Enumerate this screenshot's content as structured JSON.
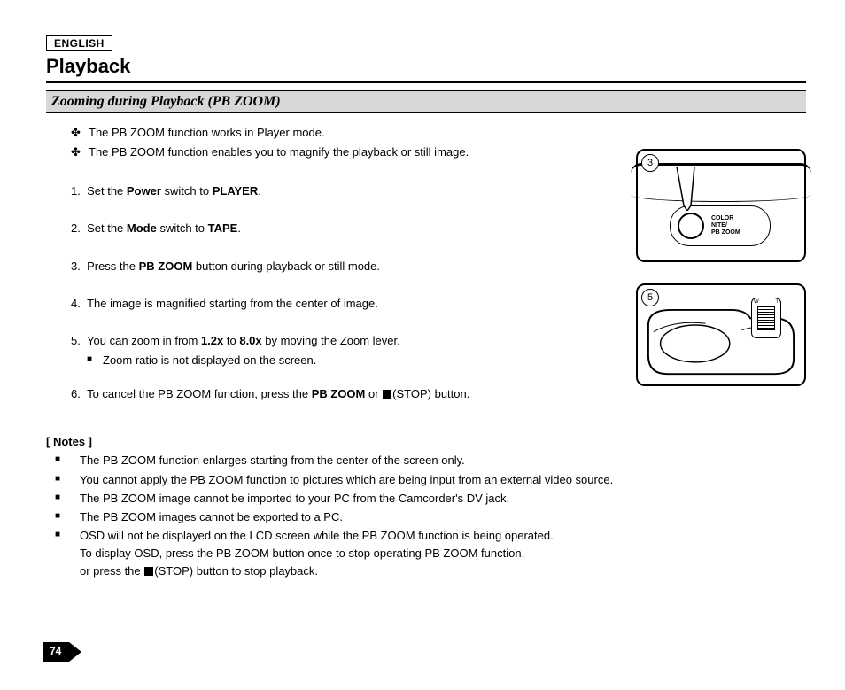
{
  "language": "ENGLISH",
  "title": "Playback",
  "section": "Zooming during Playback (PB ZOOM)",
  "intro": [
    "The PB ZOOM function works in Player mode.",
    "The PB ZOOM function enables you to magnify the playback or still image."
  ],
  "steps": {
    "s1_pre": "Set the ",
    "s1_b1": "Power",
    "s1_mid": " switch to ",
    "s1_b2": "PLAYER",
    "s1_post": ".",
    "s2_pre": "Set the ",
    "s2_b1": "Mode",
    "s2_mid": " switch to ",
    "s2_b2": "TAPE",
    "s2_post": ".",
    "s3_pre": "Press the ",
    "s3_b1": "PB ZOOM",
    "s3_post": " button during playback or still mode.",
    "s4": "The image is magnified starting from the center of image.",
    "s5_pre": "You can zoom in from ",
    "s5_b1": "1.2x",
    "s5_mid": " to ",
    "s5_b2": "8.0x",
    "s5_post": " by moving the Zoom lever.",
    "s5_sub": "Zoom ratio is not displayed on the screen.",
    "s6_pre": "To cancel the PB ZOOM function, press the ",
    "s6_b1": "PB ZOOM",
    "s6_mid": " or  ",
    "s6_post": "(STOP) button."
  },
  "notes_header": "[ Notes ]",
  "notes": [
    "The PB ZOOM function enlarges starting from the center of the screen only.",
    "You cannot apply the PB ZOOM function to pictures which are being input from an external video source.",
    "The PB ZOOM image cannot be imported to your PC from the Camcorder's DV jack.",
    "The PB ZOOM images cannot be exported to a PC."
  ],
  "note5_line1": "OSD will not be displayed on the LCD screen while the PB ZOOM function is being operated.",
  "note5_line2": "To display OSD, press the PB ZOOM button once to stop operating PB ZOOM function,",
  "note5_line3_pre": "or press the  ",
  "note5_line3_post": "(STOP) button to stop playback.",
  "fig3_num": "3",
  "fig3_label": "COLOR\nNITE/\nPB ZOOM",
  "fig5_num": "5",
  "fig5_w": "W",
  "fig5_t": "T",
  "page_number": "74"
}
